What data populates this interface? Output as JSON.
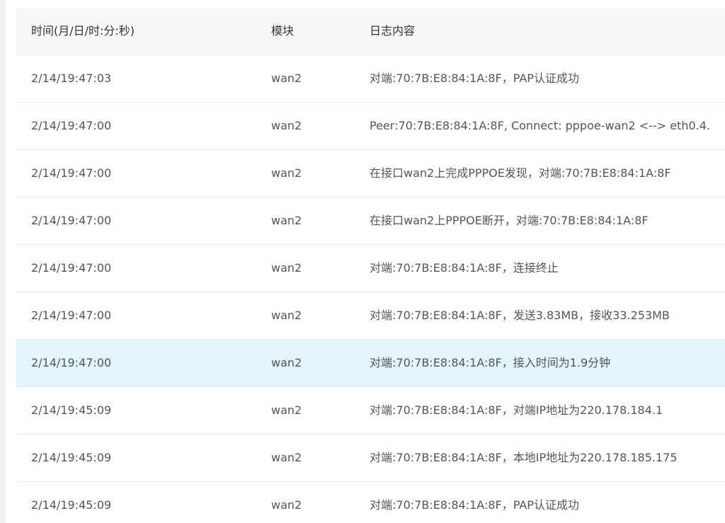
{
  "table": {
    "headers": {
      "time": "时间(月/日/时:分:秒)",
      "module": "模块",
      "content": "日志内容"
    },
    "rows": [
      {
        "time": "2/14/19:47:03",
        "module": "wan2",
        "content": "对端:70:7B:E8:84:1A:8F，PAP认证成功"
      },
      {
        "time": "2/14/19:47:00",
        "module": "wan2",
        "content": "Peer:70:7B:E8:84:1A:8F, Connect: pppoe-wan2 <--> eth0.4."
      },
      {
        "time": "2/14/19:47:00",
        "module": "wan2",
        "content": "在接口wan2上完成PPPOE发现，对端:70:7B:E8:84:1A:8F"
      },
      {
        "time": "2/14/19:47:00",
        "module": "wan2",
        "content": "在接口wan2上PPPOE断开，对端:70:7B:E8:84:1A:8F"
      },
      {
        "time": "2/14/19:47:00",
        "module": "wan2",
        "content": "对端:70:7B:E8:84:1A:8F，连接终止"
      },
      {
        "time": "2/14/19:47:00",
        "module": "wan2",
        "content": "对端:70:7B:E8:84:1A:8F，发送3.83MB，接收33.253MB"
      },
      {
        "time": "2/14/19:47:00",
        "module": "wan2",
        "content": "对端:70:7B:E8:84:1A:8F，接入时间为1.9分钟"
      },
      {
        "time": "2/14/19:45:09",
        "module": "wan2",
        "content": "对端:70:7B:E8:84:1A:8F，对端IP地址为220.178.184.1"
      },
      {
        "time": "2/14/19:45:09",
        "module": "wan2",
        "content": "对端:70:7B:E8:84:1A:8F，本地IP地址为220.178.185.175"
      },
      {
        "time": "2/14/19:45:09",
        "module": "wan2",
        "content": "对端:70:7B:E8:84:1A:8F，PAP认证成功"
      }
    ]
  },
  "colors": {
    "highlight_row": "#e4f5fc",
    "header_bg": "#f8f8f8",
    "text": "#555555"
  }
}
